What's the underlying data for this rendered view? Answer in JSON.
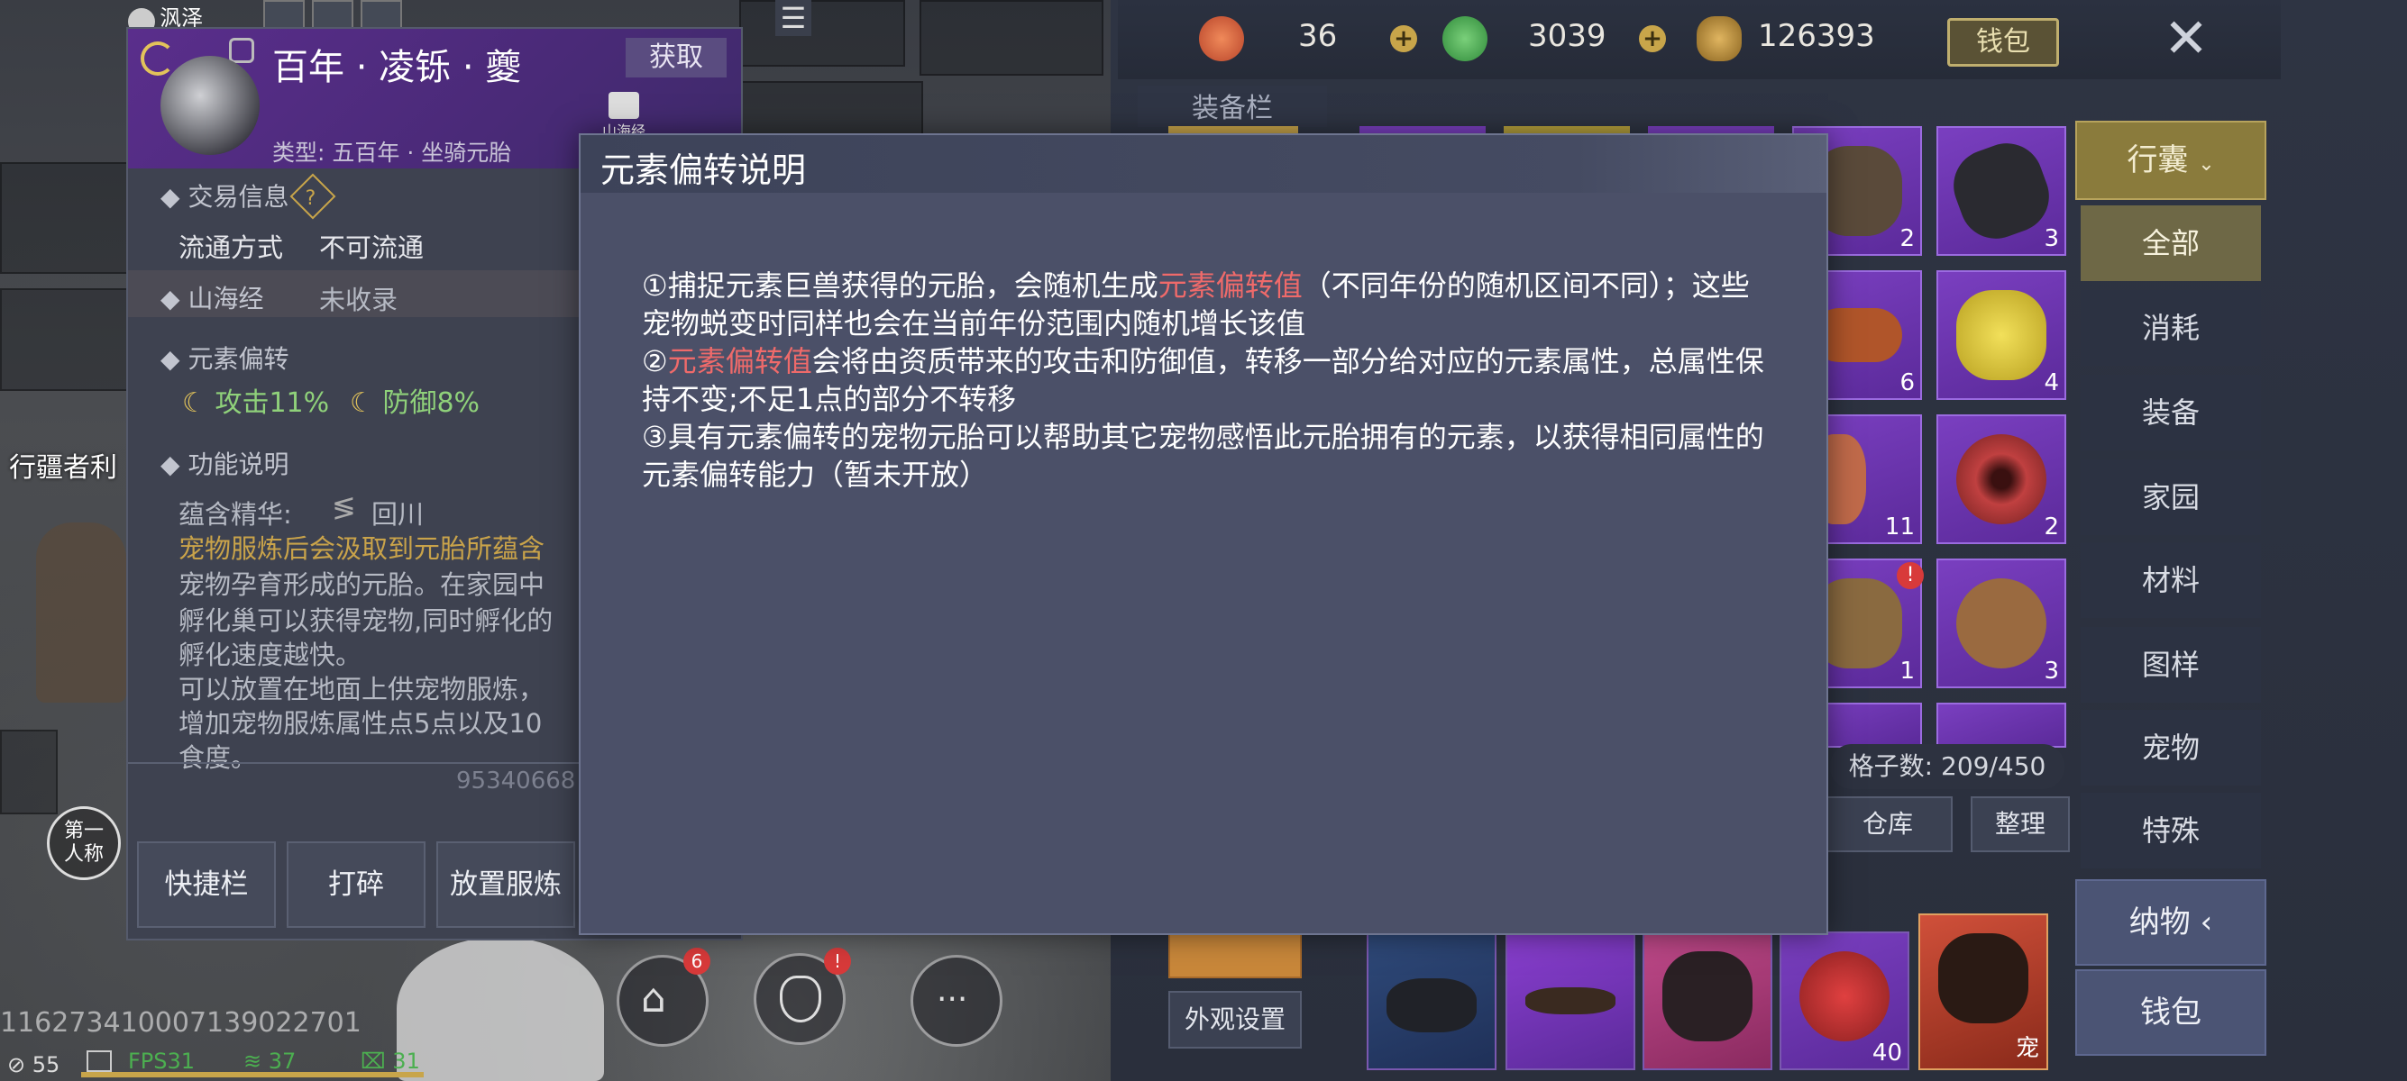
{
  "hud": {
    "location": "沨泽",
    "side_text": "行疆者利",
    "view_toggle": "第一人称",
    "player_id": "116273410007139022701",
    "ping": "55",
    "fps": "FPS31",
    "stat_a": "37",
    "stat_b": "31",
    "home_badge": "6",
    "bag_badge": "!"
  },
  "currency": {
    "items": [
      {
        "icon": "red-swirl-coin-icon",
        "value": "36"
      },
      {
        "icon": "jade-coin-icon",
        "value": "3039"
      },
      {
        "icon": "shell-coin-icon",
        "value": "126393"
      }
    ],
    "wallet_label": "钱包"
  },
  "item": {
    "title": "百年 · 凌铄 · 夔",
    "obtain_label": "获取",
    "type": "类型: 五百年 · 坐骑元胎",
    "shanhai_badge": "山海经",
    "trade_title": "交易信息",
    "circulation_label": "流通方式",
    "circulation_value": "不可流通",
    "shanhai_label": "山海经",
    "shanhai_value": "未收录",
    "element_title": "元素偏转",
    "attack": "攻击11%",
    "defense": "防御8%",
    "function_title": "功能说明",
    "essence_label": "蕴含精华:",
    "essence_value": "回川",
    "desc_gold": "宠物服炼后会汲取到元胎所蕴含",
    "desc_lines": [
      "宠物孕育形成的元胎。在家园中",
      "孵化巢可以获得宠物,同时孵化的",
      "孵化速度越快。",
      "可以放置在地面上供宠物服炼，",
      "增加宠物服炼属性点5点以及10",
      "食度。"
    ],
    "item_code": "95340668",
    "buttons": [
      "快捷栏",
      "打碎",
      "放置服炼"
    ]
  },
  "dialog": {
    "title": "元素偏转说明",
    "p1_a": "①捕捉元素巨兽获得的元胎，会随机生成",
    "p1_hl": "元素偏转值",
    "p1_b": "（不同年份的随机区间不同）；这些宠物蜕变时同样也会在当前年份范围内随机增长该值",
    "p2_a": "②",
    "p2_hl": "元素偏转值",
    "p2_b": "会将由资质带来的攻击和防御值，转移一部分给对应的元素属性，总属性保持不变;不足1点的部分不转移",
    "p3": "③具有元素偏转的宠物元胎可以帮助其它宠物感悟此元胎拥有的元素，以获得相同属性的元素偏转能力（暂未开放）"
  },
  "inventory": {
    "equip_tab": "装备栏",
    "slots": [
      {
        "count": "2",
        "art": "fungus"
      },
      {
        "count": "3",
        "art": "dark-scale"
      },
      {
        "count": "6",
        "art": "sausage"
      },
      {
        "count": "4",
        "art": "yellow-flower"
      },
      {
        "count": "11",
        "art": "coral"
      },
      {
        "count": "2",
        "art": "red-flower"
      },
      {
        "count": "1",
        "art": "hide"
      },
      {
        "count": "3",
        "art": "scroll"
      }
    ],
    "capacity": "格子数: 209/450",
    "warehouse": "仓库",
    "sort": "整理",
    "appearance": "外观设置",
    "bottom_slots": [
      {
        "count": "",
        "art": "crossbow"
      },
      {
        "count": "",
        "art": "rifle"
      },
      {
        "count": "",
        "art": "claw"
      },
      {
        "count": "40",
        "art": "berries"
      },
      {
        "count": "",
        "art": "pet-weapon",
        "tag": "宠"
      }
    ]
  },
  "categories": {
    "top": "行囊",
    "items": [
      "全部",
      "消耗",
      "装备",
      "家园",
      "材料",
      "图样",
      "宠物",
      "特殊"
    ],
    "nawu": "纳物",
    "wallet": "钱包"
  }
}
